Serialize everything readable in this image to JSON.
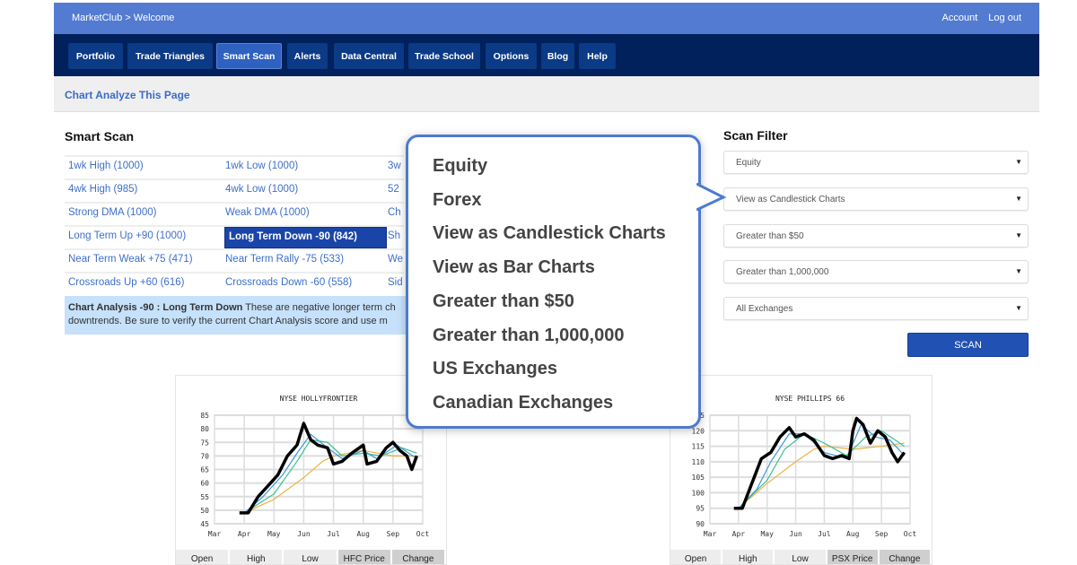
{
  "topbar": {
    "breadcrumb": "MarketClub > Welcome",
    "account": "Account",
    "logout": "Log out"
  },
  "nav": [
    "Portfolio",
    "Trade Triangles",
    "Smart Scan",
    "Alerts",
    "Data Central",
    "Trade School",
    "Options",
    "Blog",
    "Help"
  ],
  "nav_active": "Smart Scan",
  "subheader": {
    "link": "Chart Analyze This Page"
  },
  "smart_scan": {
    "title": "Smart Scan",
    "rows": [
      [
        "1wk High (1000)",
        "1wk Low (1000)",
        "3w"
      ],
      [
        "4wk High (985)",
        "4wk Low (1000)",
        "52"
      ],
      [
        "Strong DMA (1000)",
        "Weak DMA (1000)",
        "Ch"
      ],
      [
        "Long Term Up +90 (1000)",
        "Long Term Down -90 (842)",
        "Sh"
      ],
      [
        "Near Term Weak +75 (471)",
        "Near Term Rally -75 (533)",
        "We"
      ],
      [
        "Crossroads Up +60 (616)",
        "Crossroads Down -60 (558)",
        "Sid"
      ]
    ],
    "selected": "Long Term Down -90 (842)",
    "info_bold": "Chart Analysis -90 : Long Term Down",
    "info_line1": " These are negative longer term ch",
    "info_line2": "downtrends. Be sure to verify the current Chart Analysis score and use m"
  },
  "callout": {
    "items": [
      "Equity",
      "Forex",
      "View as Candlestick Charts",
      "View as Bar Charts",
      "Greater than $50",
      "Greater than 1,000,000",
      "US Exchanges",
      "Canadian Exchanges"
    ]
  },
  "scan_filter": {
    "title": "Scan Filter",
    "selects": [
      "Equity",
      "View as Candlestick Charts",
      "Greater than $50",
      "Greater than 1,000,000",
      "All Exchanges"
    ],
    "button": "SCAN"
  },
  "colors": {
    "topbar": "#527bd1",
    "nav": "#00215c",
    "accent": "#2151b3",
    "callout_border": "#4d7ad0",
    "price": "#000000",
    "ma_fast": "#3a9ad9",
    "ma_mid": "#3cbf9a",
    "ma_slow": "#f0b040"
  },
  "chart_data": [
    {
      "type": "line",
      "title": "NYSE HOLLYFRONTIER",
      "ylim": [
        45,
        85
      ],
      "yticks": [
        "85",
        "80",
        "75",
        "70",
        "65",
        "60",
        "55",
        "50",
        "45"
      ],
      "xticks": [
        "Mar",
        "Apr",
        "May",
        "Jun",
        "Jul",
        "Aug",
        "Sep",
        "Oct"
      ],
      "table_headers": [
        "Open",
        "High",
        "Low",
        "HFC Price",
        "Change"
      ],
      "series": [
        {
          "role": "price",
          "points": [
            [
              "Mar 27",
              49
            ],
            [
              "Apr 5",
              49
            ],
            [
              "Apr 15",
              55
            ],
            [
              "Apr 25",
              59
            ],
            [
              "May 5",
              63
            ],
            [
              "May 15",
              70
            ],
            [
              "May 25",
              74
            ],
            [
              "Jun 1",
              82
            ],
            [
              "Jun 8",
              76
            ],
            [
              "Jun 15",
              74
            ],
            [
              "Jun 25",
              73
            ],
            [
              "Jul 1",
              67
            ],
            [
              "Jul 10",
              68
            ],
            [
              "Jul 20",
              71
            ],
            [
              "Aug 1",
              74
            ],
            [
              "Aug 5",
              67
            ],
            [
              "Aug 15",
              68
            ],
            [
              "Aug 25",
              73
            ],
            [
              "Sep 1",
              75
            ],
            [
              "Sep 8",
              72
            ],
            [
              "Sep 15",
              70
            ],
            [
              "Sep 20",
              65
            ],
            [
              "Sep 25",
              70
            ]
          ]
        },
        {
          "role": "ma_fast",
          "points": [
            [
              "Apr 1",
              49
            ],
            [
              "Apr 20",
              55
            ],
            [
              "May 10",
              63
            ],
            [
              "May 25",
              71
            ],
            [
              "Jun 8",
              78
            ],
            [
              "Jun 25",
              73
            ],
            [
              "Jul 10",
              69
            ],
            [
              "Aug 1",
              72
            ],
            [
              "Aug 15",
              69
            ],
            [
              "Sep 5",
              74
            ],
            [
              "Sep 25",
              69
            ]
          ]
        },
        {
          "role": "ma_mid",
          "points": [
            [
              "Apr 1",
              49
            ],
            [
              "May 1",
              56
            ],
            [
              "May 25",
              68
            ],
            [
              "Jun 8",
              76
            ],
            [
              "Jun 25",
              75
            ],
            [
              "Jul 10",
              70
            ],
            [
              "Aug 1",
              71
            ],
            [
              "Aug 20",
              70
            ],
            [
              "Sep 10",
              73
            ],
            [
              "Sep 25",
              71
            ]
          ]
        },
        {
          "role": "ma_slow",
          "points": [
            [
              "Apr 1",
              49
            ],
            [
              "May 1",
              54
            ],
            [
              "Jun 1",
              62
            ],
            [
              "Jun 20",
              68
            ],
            [
              "Jul 1",
              70
            ],
            [
              "Aug 1",
              72
            ],
            [
              "Sep 1",
              70
            ],
            [
              "Sep 25",
              70
            ]
          ]
        }
      ]
    },
    {
      "type": "line",
      "title": "NYSE PHILLIPS 66",
      "ylim": [
        90,
        125
      ],
      "yticks": [
        "125",
        "120",
        "115",
        "110",
        "105",
        "100",
        "95",
        "90"
      ],
      "xticks": [
        "Mar",
        "Apr",
        "May",
        "Jun",
        "Jul",
        "Aug",
        "Sep",
        "Oct"
      ],
      "table_headers": [
        "Open",
        "High",
        "Low",
        "PSX Price",
        "Change"
      ],
      "series": [
        {
          "role": "price",
          "points": [
            [
              "Mar 27",
              95
            ],
            [
              "Apr 5",
              95
            ],
            [
              "Apr 15",
              103
            ],
            [
              "Apr 25",
              111
            ],
            [
              "May 5",
              113
            ],
            [
              "May 15",
              118
            ],
            [
              "May 25",
              121
            ],
            [
              "Jun 1",
              118
            ],
            [
              "Jun 10",
              119
            ],
            [
              "Jun 20",
              117
            ],
            [
              "Jul 1",
              112
            ],
            [
              "Jul 10",
              111
            ],
            [
              "Jul 20",
              112
            ],
            [
              "Jul 28",
              111
            ],
            [
              "Aug 1",
              120
            ],
            [
              "Aug 5",
              124
            ],
            [
              "Aug 12",
              122
            ],
            [
              "Aug 20",
              116
            ],
            [
              "Aug 28",
              120
            ],
            [
              "Sep 5",
              118
            ],
            [
              "Sep 12",
              113
            ],
            [
              "Sep 18",
              110
            ],
            [
              "Sep 25",
              113
            ]
          ]
        },
        {
          "role": "ma_fast",
          "points": [
            [
              "Apr 1",
              95
            ],
            [
              "Apr 20",
              101
            ],
            [
              "May 5",
              110
            ],
            [
              "May 25",
              119
            ],
            [
              "Jun 10",
              119
            ],
            [
              "Jul 1",
              113
            ],
            [
              "Jul 25",
              111
            ],
            [
              "Aug 10",
              122
            ],
            [
              "Aug 25",
              118
            ],
            [
              "Sep 10",
              117
            ],
            [
              "Sep 25",
              112
            ]
          ]
        },
        {
          "role": "ma_mid",
          "points": [
            [
              "Apr 1",
              95
            ],
            [
              "May 1",
              104
            ],
            [
              "May 20",
              114
            ],
            [
              "Jun 10",
              119
            ],
            [
              "Jul 1",
              116
            ],
            [
              "Jul 25",
              112
            ],
            [
              "Aug 15",
              118
            ],
            [
              "Sep 1",
              120
            ],
            [
              "Sep 25",
              115
            ]
          ]
        },
        {
          "role": "ma_slow",
          "points": [
            [
              "Apr 1",
              95
            ],
            [
              "May 1",
              103
            ],
            [
              "Jun 1",
              110
            ],
            [
              "Jun 20",
              114
            ],
            [
              "Jul 1",
              115
            ],
            [
              "Aug 1",
              114
            ],
            [
              "Sep 1",
              115
            ],
            [
              "Sep 25",
              116
            ]
          ]
        }
      ]
    }
  ]
}
